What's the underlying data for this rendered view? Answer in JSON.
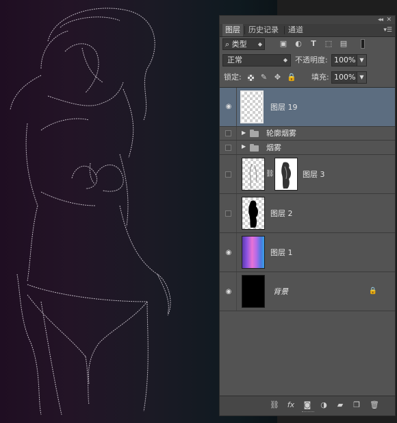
{
  "panel": {
    "tabs": [
      {
        "label": "图层",
        "active": true
      },
      {
        "label": "历史记录",
        "active": false
      },
      {
        "label": "通道",
        "active": false
      }
    ],
    "filter": {
      "label": "类型"
    },
    "blend_mode": "正常",
    "opacity_label": "不透明度:",
    "opacity_value": "100%",
    "lock_label": "锁定:",
    "fill_label": "填充:",
    "fill_value": "100%"
  },
  "layers": [
    {
      "name": "图层 19",
      "visible": true,
      "selected": true,
      "kind": "pixel"
    },
    {
      "name": "轮廓烟雾",
      "visible": false,
      "kind": "group"
    },
    {
      "name": "烟雾",
      "visible": false,
      "kind": "group"
    },
    {
      "name": "图层 3",
      "visible": false,
      "kind": "masked"
    },
    {
      "name": "图层 2",
      "visible": false,
      "kind": "pixel"
    },
    {
      "name": "图层 1",
      "visible": true,
      "kind": "pixel"
    },
    {
      "name": "背景",
      "visible": true,
      "kind": "background",
      "locked": true
    }
  ],
  "colors": {
    "panel_bg": "#535353",
    "selected_layer": "#5c6d80",
    "canvas_purple": "#231426",
    "canvas_teal": "#0f1a20"
  },
  "icons": [
    "collapse-icon",
    "close-icon",
    "panel-menu-icon",
    "search-icon",
    "image-filter-icon",
    "adjustment-filter-icon",
    "type-filter-icon",
    "shape-filter-icon",
    "smart-filter-icon",
    "lock-transparent-icon",
    "lock-paint-icon",
    "lock-position-icon",
    "lock-all-icon",
    "eye-icon",
    "folder-icon",
    "chain-link-icon",
    "lock-icon",
    "link-layers-icon",
    "fx-icon",
    "mask-icon",
    "adjustment-layer-icon",
    "new-group-icon",
    "new-layer-icon",
    "trash-icon"
  ]
}
